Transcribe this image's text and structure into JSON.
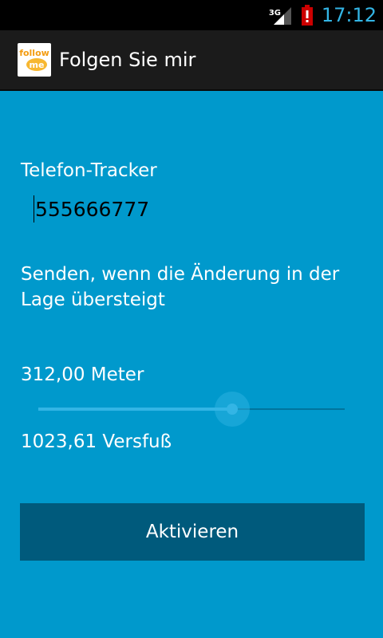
{
  "status_bar": {
    "network": "3G",
    "time": "17:12",
    "icons": [
      "signal-icon",
      "battery-alert-icon"
    ],
    "colors": {
      "clock": "#33b5e5",
      "battery_alert": "#cc0000"
    }
  },
  "action_bar": {
    "app_title": "Folgen Sie mir",
    "app_icon": {
      "name": "follow-me-logo-icon",
      "text_top": "follow",
      "text_bottom": "me"
    }
  },
  "form": {
    "phone_label": "Telefon-Tracker",
    "phone_value": "555666777",
    "threshold_label": "Senden, wenn die Änderung in der Lage übersteigt",
    "meters_value": "312,00 Meter",
    "slider": {
      "fraction": 0.632
    },
    "feet_value": "1023,61 Versfuß",
    "activate_label": "Aktivieren"
  },
  "colors": {
    "background": "#0099cc",
    "button": "#005a7c",
    "accent": "#33b5e5"
  }
}
